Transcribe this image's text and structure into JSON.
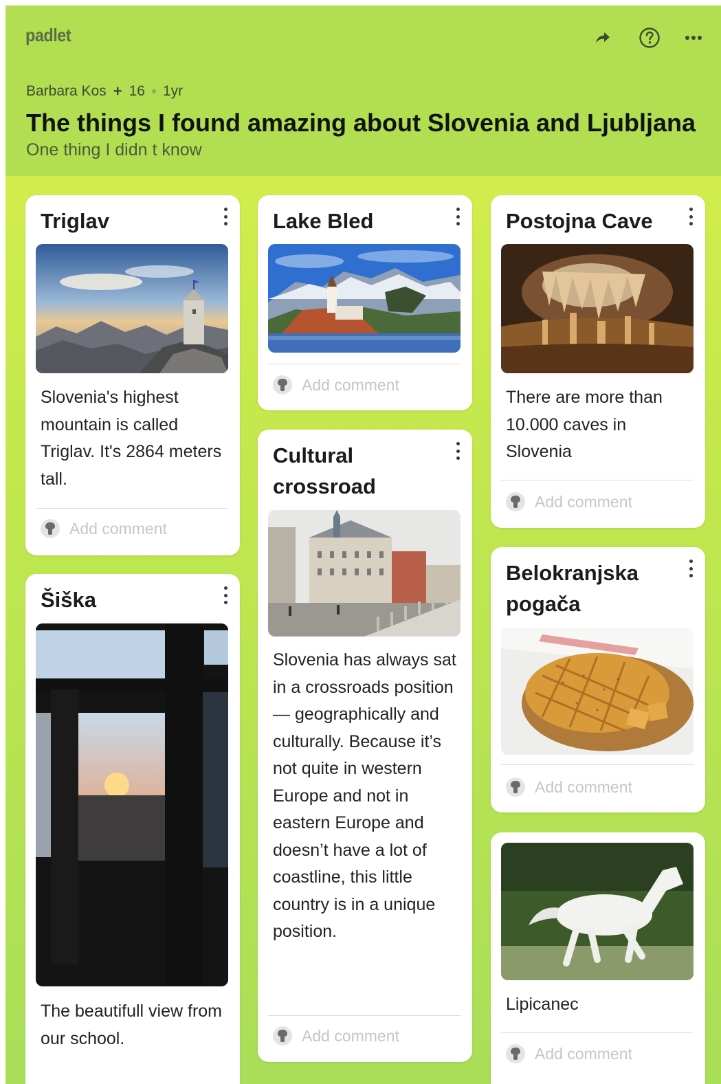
{
  "header": {
    "logo": "padlet",
    "author": "Barbara Kos",
    "plus": "+",
    "likes": "16",
    "age": "1yr",
    "title": "The things I found amazing about Slovenia and Ljubljana",
    "subtitle": "One thing I didn t know",
    "icons": [
      "share-icon",
      "help-icon",
      "more-icon"
    ]
  },
  "add_comment_label": "Add comment",
  "cards": {
    "triglav": {
      "title": "Triglav",
      "text": "Slovenia's highest mountain is called Triglav. It's 2864 meters tall."
    },
    "siska": {
      "title": "Šiška",
      "text": "The beautifull view from our school."
    },
    "lake_bled": {
      "title": "Lake Bled"
    },
    "cultural": {
      "title": "Cultural crossroad",
      "text": "Slovenia has always sat in a crossroads position — geographically and culturally. Because it’s not quite in western Europe and not in eastern Europe and doesn’t have a lot of coastline, this little country is in a unique position."
    },
    "postojna": {
      "title": "Postojna Cave",
      "text": "There are more than 10.000 caves in Slovenia"
    },
    "belokranjska": {
      "title": "Belokranjska pogača"
    },
    "lipicanec": {
      "text": "Lipicanec"
    }
  },
  "colors": {
    "header_bg": "#b2df52",
    "board_top": "#dcef4e",
    "board_bottom": "#a9de58",
    "card_bg": "#ffffff",
    "placeholder_text": "#c6c6c6"
  }
}
